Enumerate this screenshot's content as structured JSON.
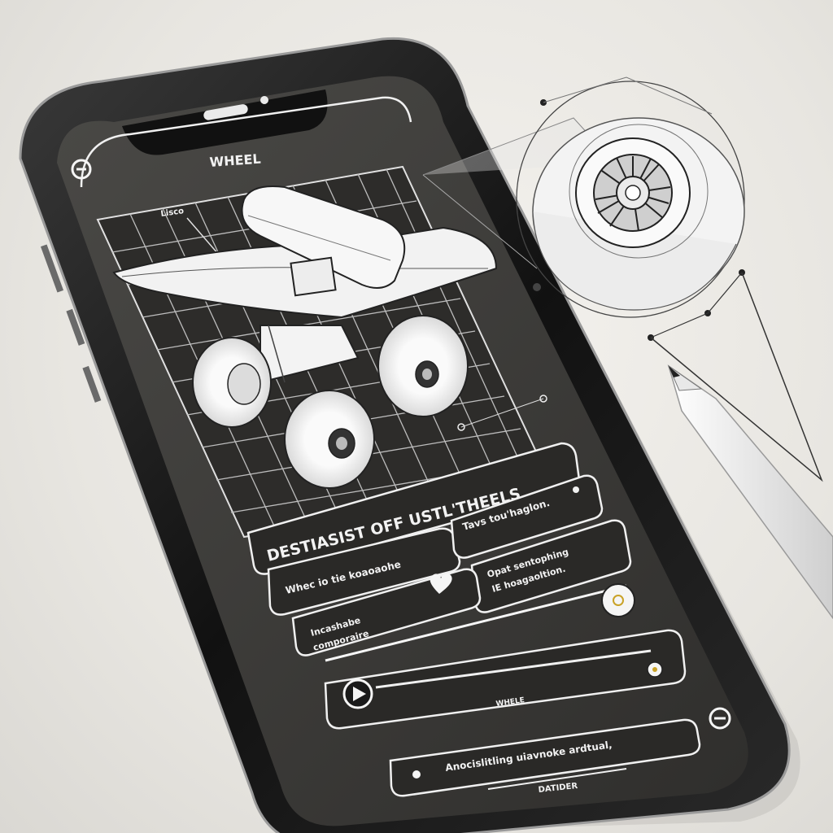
{
  "screen": {
    "header_label": "WHEEL",
    "callout_label": "Lisco",
    "headline": "DESTIASIST OFF USTL'THEELS",
    "cards": [
      {
        "text": "Whec io tie koaoaohe"
      },
      {
        "text": "Tavs tou'haglon."
      },
      {
        "text": "Opat sentophing",
        "text2": "IE hoagaoltion."
      },
      {
        "text": "Incashabe",
        "text2": "comporaire"
      }
    ],
    "player_label": "WHELE",
    "footer_card_text": "Anocislitling uiavnoke ardtual,",
    "footer_label": "DATIDER"
  },
  "colors": {
    "phone_body": "#1b1b1b",
    "screen_bg": "#3a3936",
    "grid_line": "#bdbdbd",
    "ui_outline": "#f5f5f5",
    "paper": "#ecebe7"
  },
  "icons": {
    "heart": "heart-icon",
    "play": "play-icon",
    "slider_knob": "slider-knob-icon"
  }
}
